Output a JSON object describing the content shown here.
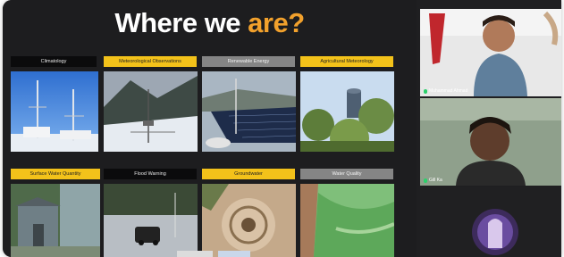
{
  "slide": {
    "title_main": "Where we ",
    "title_accent": "are?",
    "tiles": [
      {
        "label": "Climatology",
        "style": "dark",
        "image": "weather-station-photo"
      },
      {
        "label": "Meteorological Observations",
        "style": "yellow",
        "image": "snow-instrument-photo"
      },
      {
        "label": "Renewable Energy",
        "style": "grey",
        "image": "solar-panels-photo"
      },
      {
        "label": "Agricultural Meteorology",
        "style": "yellow",
        "image": "water-tank-trees-photo"
      },
      {
        "label": "Surface Water Quantity",
        "style": "yellow",
        "image": "river-gauge-hut-photo"
      },
      {
        "label": "Flood Warning",
        "style": "dark",
        "image": "flooded-road-photo"
      },
      {
        "label": "Groundwater",
        "style": "yellow",
        "image": "well-aerial-photo"
      },
      {
        "label": "Water Quality",
        "style": "grey",
        "image": "algae-lake-photo"
      }
    ]
  },
  "participants": [
    {
      "name": "Muhammad Ahmad",
      "tile": "participant-video-1"
    },
    {
      "name": "Gill Ka",
      "tile": "participant-video-2"
    },
    {
      "name": "",
      "tile": "participant-avatar-3"
    }
  ],
  "colors": {
    "accent": "#f2a12c",
    "label_yellow": "#f3c21a",
    "label_grey": "#858585",
    "label_dark": "#0b0b0c",
    "background": "#1d1d1f"
  }
}
